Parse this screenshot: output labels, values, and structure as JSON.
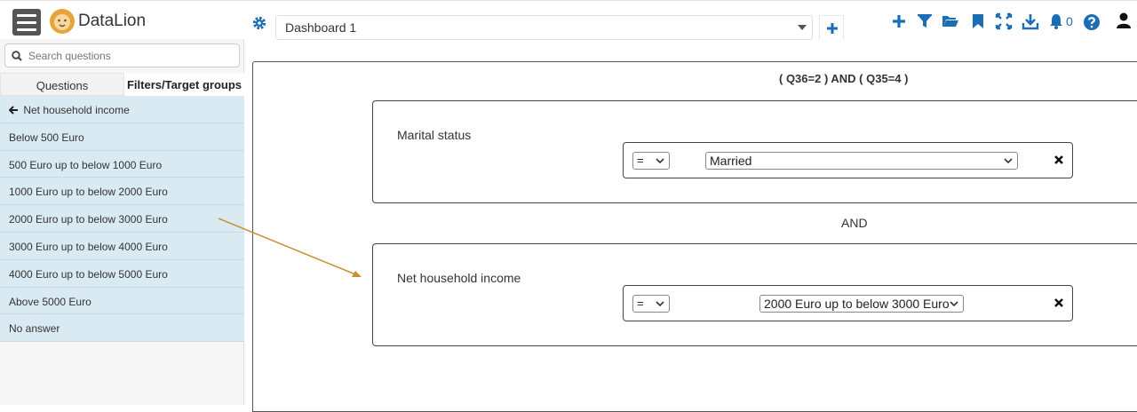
{
  "app": {
    "brand": "DataLion"
  },
  "dashboard": {
    "selected": "Dashboard 1"
  },
  "toolbar": {
    "notifications_count": "0"
  },
  "sidebar": {
    "search_placeholder": "Search questions",
    "tabs": [
      "Questions",
      "Filters/Target groups"
    ],
    "back_label": "Net household income",
    "items": [
      "Below 500 Euro",
      "500 Euro up to below 1000 Euro",
      "1000 Euro up to below 2000 Euro",
      "2000 Euro up to below 3000 Euro",
      "3000 Euro up to below 4000 Euro",
      "4000 Euro up to below 5000 Euro",
      "Above 5000 Euro",
      "No answer"
    ]
  },
  "filter": {
    "expression": "( Q36=2 ) AND ( Q35=4 )",
    "connector": "AND",
    "conditions": [
      {
        "label": "Marital status",
        "operator": "=",
        "value": "Married"
      },
      {
        "label": "Net household income",
        "operator": "=",
        "value": "2000 Euro up to below 3000 Euro"
      }
    ]
  },
  "colors": {
    "accent": "#1b6eb5",
    "list_bg": "#daeaf3",
    "arrow": "#c8902e"
  },
  "icons": [
    "menu-icon",
    "lion-logo-icon",
    "gear-icon",
    "plus-icon",
    "filter-icon",
    "folder-open-icon",
    "bookmark-icon",
    "fullscreen-icon",
    "download-icon",
    "bell-icon",
    "help-icon",
    "user-icon",
    "search-icon",
    "arrow-left-icon",
    "close-icon"
  ]
}
